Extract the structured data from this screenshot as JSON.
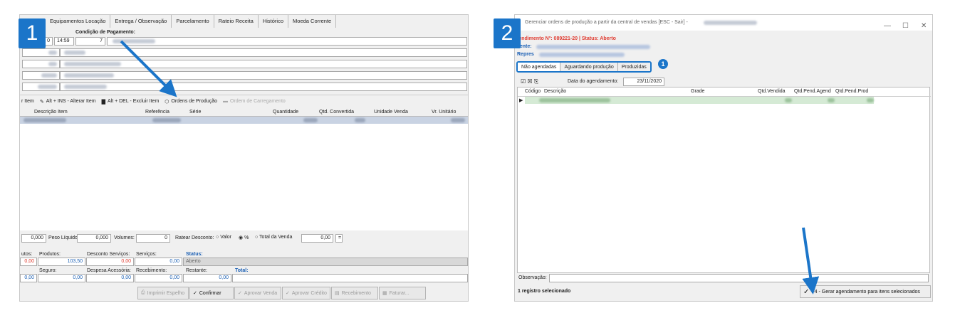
{
  "steps": [
    "1",
    "2"
  ],
  "panel1": {
    "tabs": [
      "Equipamentos Locação",
      "Entrega / Observação",
      "Parcelamento",
      "Rateio Receita",
      "Histórico",
      "Moeda Corrente"
    ],
    "cond_label": "Condição de Pagamento:",
    "date_suffix": "0",
    "time": "14:59",
    "cond_value": "7",
    "toolbar": {
      "item": "r Item",
      "alterar": "Alt + INS - Alterar Item",
      "excluir": "Alt + DEL - Excluir Item",
      "ordens": "Ordens de Produção",
      "carregamento": "Ordem de Carregamento"
    },
    "columns": [
      "Descrição Item",
      "Referência",
      "Série",
      "Quantidade",
      "Qtd. Convertida",
      "Unidade Venda",
      "Vr. Unitário"
    ],
    "footer": {
      "val1": "0,000",
      "peso_label": "Peso Líquido:",
      "peso": "0,000",
      "vol_label": "Volumes:",
      "vol": "0",
      "ratear_label": "Ratear Desconto:",
      "opt_valor": "Valor",
      "opt_pct": "%",
      "opt_total": "Total da Venda",
      "desc_val": "0,00",
      "utos_label": "utos:",
      "produtos_label": "Produtos:",
      "desc_serv_label": "Desconto Serviços:",
      "servicos_label": "Serviços:",
      "status_label": "Status:",
      "utos_val": "0,00",
      "produtos_val": "103,50",
      "desc_serv_val": "0,00",
      "servicos_val": "0,00",
      "status_val": "Aberto",
      "seguro_label": "Seguro:",
      "despesa_label": "Despesa Acessória:",
      "receb_label": "Recebimento:",
      "restante_label": "Restante:",
      "total_label": "Total:",
      "r2a": "0,00",
      "seguro_val": "0,00",
      "despesa_val": "0,00",
      "receb_val": "0,00",
      "restante_val": "0,00"
    },
    "buttons": {
      "imprimir": "Imprimir Espelho",
      "confirmar": "Confirmar",
      "aprovar_venda": "Aprovar Venda",
      "aprovar_credito": "Aprovar Crédito",
      "recebimento": "Recebimento",
      "faturar": "Faturar..."
    }
  },
  "panel2": {
    "title": "Gerenciar ordens de produção a partir da central de vendas [ESC - Sair] -",
    "atendimento": "tendimento Nº: 089221-20 | Status: Aberto",
    "cliente_label": "liente:",
    "repres_label": "Repres",
    "tabs": [
      "Não agendadas",
      "Aguardando produção",
      "Produzidas"
    ],
    "badge": "1",
    "data_label": "Data do agendamento:",
    "data_value": "23/11/2020",
    "columns": [
      "Código",
      "Descrição",
      "Grade",
      "Qtd.Vendida",
      "Qtd.Pend.Agend",
      "Qtd.Pend.Prod"
    ],
    "obs_label": "Observação:",
    "status": "1 registro selecionado",
    "gerar_button": "F4 - Gerar agendamento para itens selecionados"
  },
  "colors": {
    "accent": "#1b75c9",
    "status_red": "#e03c31",
    "link_blue": "#1a5fb4"
  }
}
